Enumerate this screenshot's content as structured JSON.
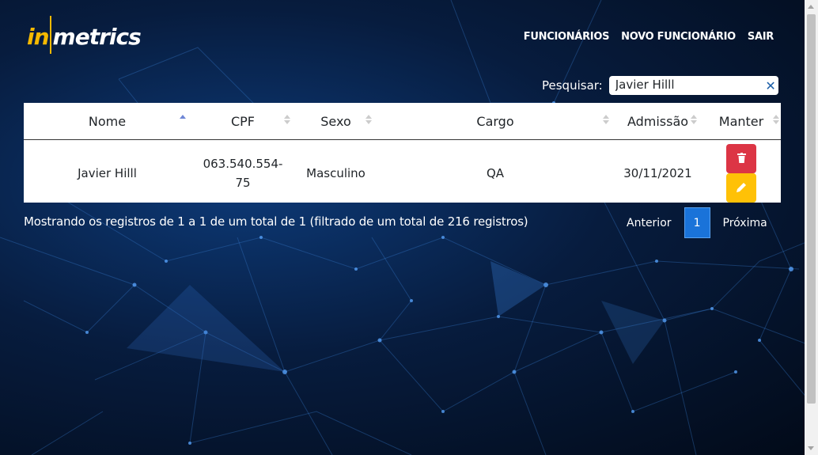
{
  "logo": {
    "part1": "in",
    "part2": "metrics"
  },
  "nav": {
    "employees": "FUNCIONÁRIOS",
    "new_employee": "NOVO FUNCIONÁRIO",
    "logout": "SAIR"
  },
  "search": {
    "label": "Pesquisar:",
    "value": "Javier Hilll",
    "clear_icon": "close-icon"
  },
  "table": {
    "columns": [
      "Nome",
      "CPF",
      "Sexo",
      "Cargo",
      "Admissão",
      "Manter"
    ],
    "sorted_column": "Nome",
    "rows": [
      {
        "nome": "Javier Hilll",
        "cpf": "063.540.554-75",
        "sexo": "Masculino",
        "cargo": "QA",
        "admissao": "30/11/2021"
      }
    ],
    "actions": {
      "delete_icon": "trash-icon",
      "edit_icon": "pencil-icon"
    }
  },
  "info": "Mostrando os registros de 1 a 1 de um total de 1 (filtrado de um total de 216 registros)",
  "pagination": {
    "previous": "Anterior",
    "current": "1",
    "next": "Próxima"
  },
  "colors": {
    "accent": "#f5b900",
    "danger": "#dc3545",
    "warning": "#ffc107",
    "primary": "#1a73d9"
  }
}
